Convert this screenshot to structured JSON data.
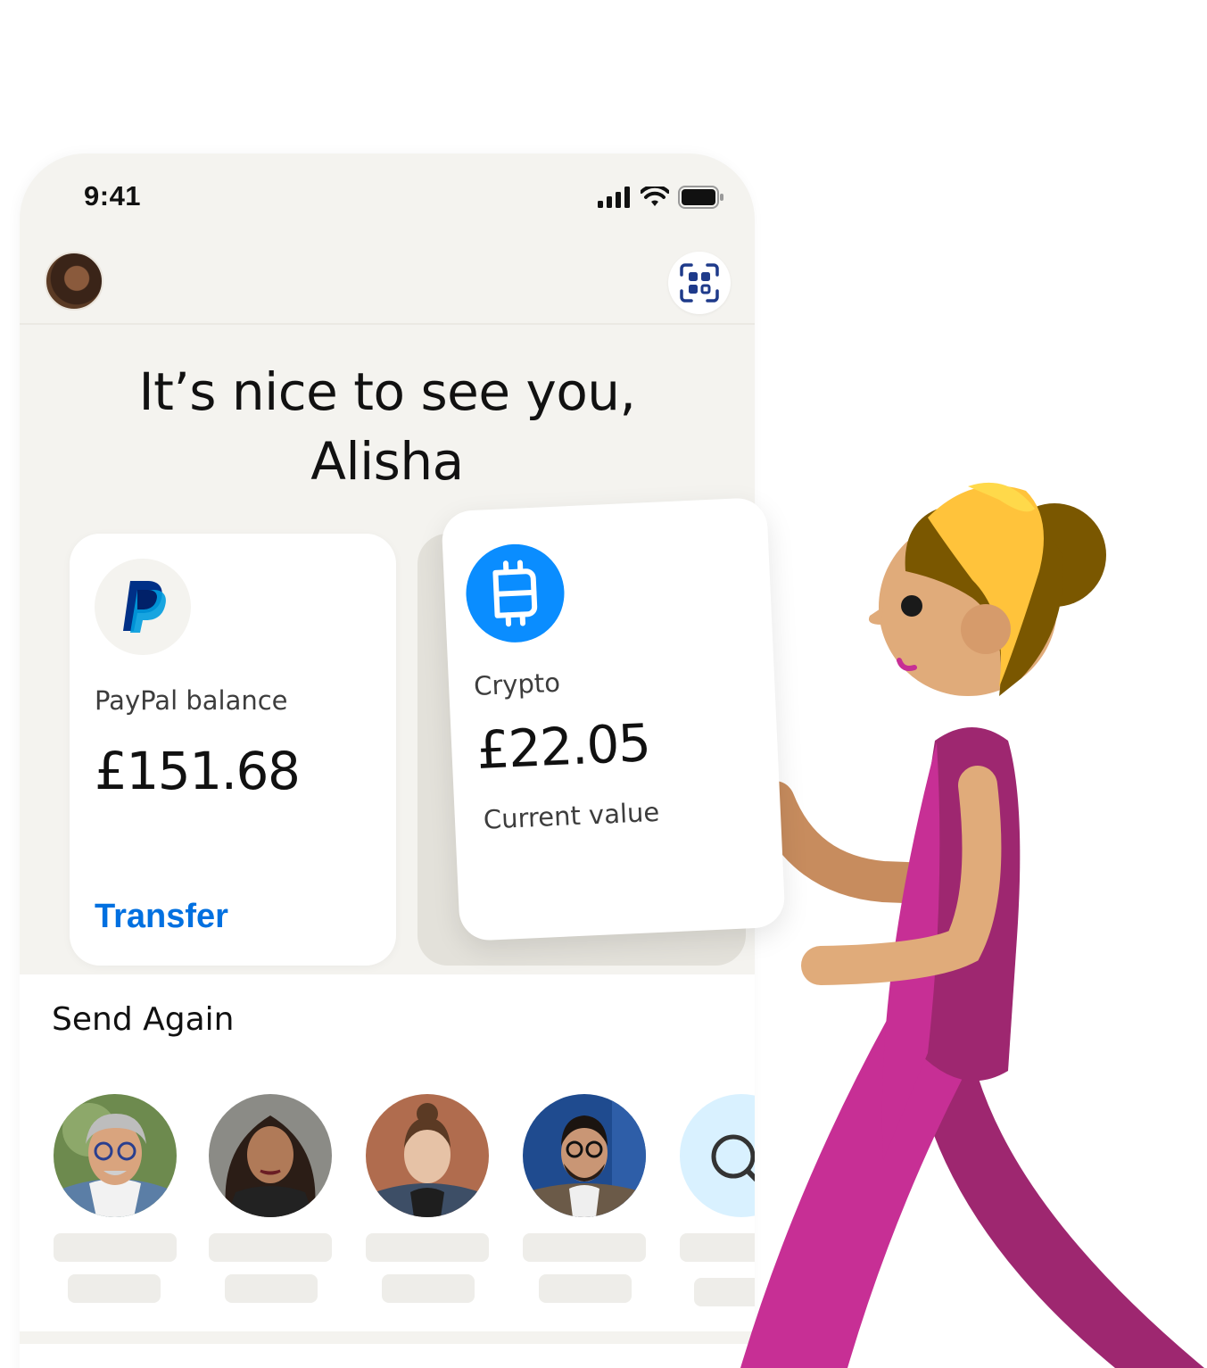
{
  "status_bar": {
    "time": "9:41",
    "icons": [
      "signal-icon",
      "wifi-icon",
      "battery-icon"
    ]
  },
  "header": {
    "avatar": "user-avatar",
    "qr_icon": "qr-scan-icon"
  },
  "greeting": {
    "line1": "It’s nice to see you,",
    "line2": "Alisha"
  },
  "balance_card": {
    "icon": "paypal-logo-icon",
    "label": "PayPal balance",
    "amount": "£151.68",
    "action": "Transfer"
  },
  "crypto_card": {
    "icon": "bitcoin-icon",
    "label": "Crypto",
    "amount": "£22.05",
    "caption": "Current value"
  },
  "send_again": {
    "title": "Send Again",
    "contacts": [
      "contact-avatar",
      "contact-avatar",
      "contact-avatar",
      "contact-avatar"
    ],
    "search_icon": "search-icon"
  },
  "colors": {
    "accent_blue": "#0070e0",
    "crypto_blue": "#0a8dff",
    "phone_bg": "#f4f3ef",
    "paypal_dark": "#003087",
    "paypal_light": "#009cde",
    "illustration_magenta": "#c72f95",
    "illustration_plum": "#9e2770",
    "illustration_yellow": "#ffc33b"
  }
}
